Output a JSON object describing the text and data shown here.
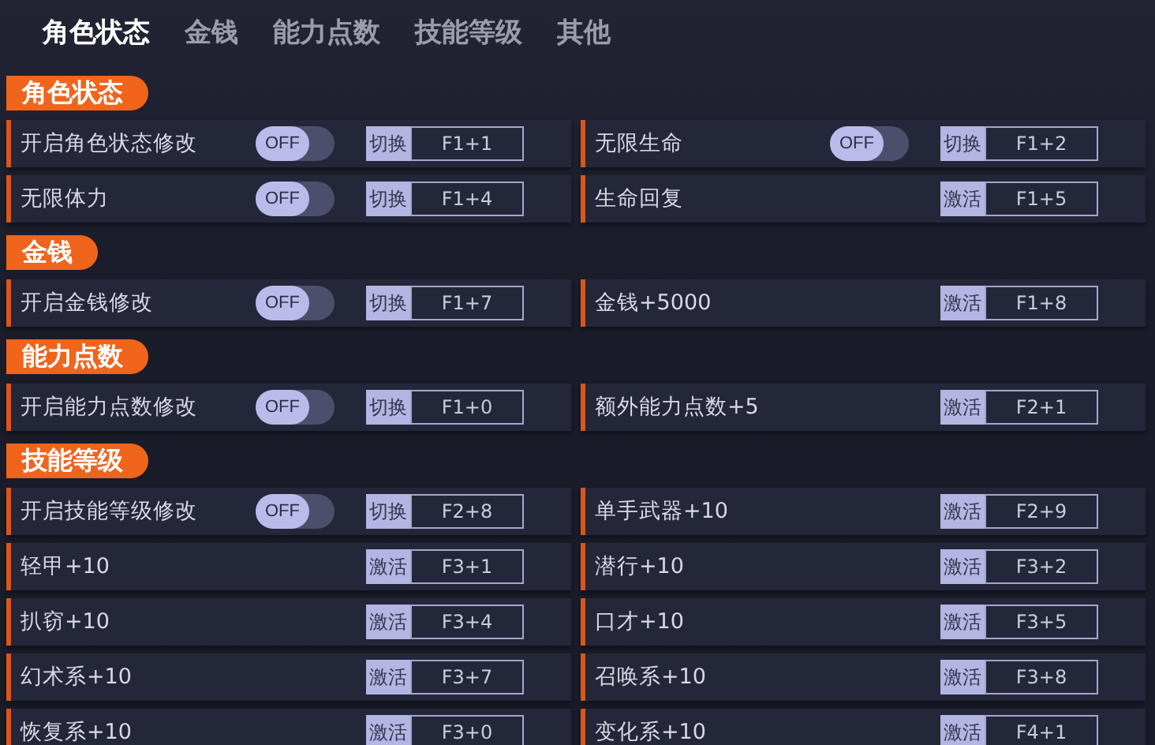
{
  "tabs": [
    {
      "label": "角色状态",
      "selected": true
    },
    {
      "label": "金钱",
      "selected": false
    },
    {
      "label": "能力点数",
      "selected": false
    },
    {
      "label": "技能等级",
      "selected": false
    },
    {
      "label": "其他",
      "selected": false
    }
  ],
  "sections": [
    {
      "title": "角色状态",
      "items": [
        {
          "label": "开启角色状态修改",
          "toggle": {
            "text": "OFF",
            "on": false
          },
          "action": "切换",
          "hotkey": "F1+1"
        },
        {
          "label": "无限生命",
          "toggle": {
            "text": "OFF",
            "on": false
          },
          "action": "切换",
          "hotkey": "F1+2"
        },
        {
          "label": "无限体力",
          "toggle": {
            "text": "OFF",
            "on": false
          },
          "action": "切换",
          "hotkey": "F1+4"
        },
        {
          "label": "生命回复",
          "action": "激活",
          "hotkey": "F1+5"
        }
      ]
    },
    {
      "title": "金钱",
      "items": [
        {
          "label": "开启金钱修改",
          "toggle": {
            "text": "OFF",
            "on": false
          },
          "action": "切换",
          "hotkey": "F1+7"
        },
        {
          "label": "金钱+5000",
          "action": "激活",
          "hotkey": "F1+8"
        }
      ]
    },
    {
      "title": "能力点数",
      "items": [
        {
          "label": "开启能力点数修改",
          "toggle": {
            "text": "OFF",
            "on": false
          },
          "action": "切换",
          "hotkey": "F1+0"
        },
        {
          "label": "额外能力点数+5",
          "action": "激活",
          "hotkey": "F2+1"
        }
      ]
    },
    {
      "title": "技能等级",
      "items": [
        {
          "label": "开启技能等级修改",
          "toggle": {
            "text": "OFF",
            "on": false
          },
          "action": "切换",
          "hotkey": "F2+8"
        },
        {
          "label": "单手武器+10",
          "action": "激活",
          "hotkey": "F2+9"
        },
        {
          "label": "轻甲+10",
          "action": "激活",
          "hotkey": "F3+1"
        },
        {
          "label": "潜行+10",
          "action": "激活",
          "hotkey": "F3+2"
        },
        {
          "label": "扒窃+10",
          "action": "激活",
          "hotkey": "F3+4"
        },
        {
          "label": "口才+10",
          "action": "激活",
          "hotkey": "F3+5"
        },
        {
          "label": "幻术系+10",
          "action": "激活",
          "hotkey": "F3+7"
        },
        {
          "label": "召唤系+10",
          "action": "激活",
          "hotkey": "F3+8"
        },
        {
          "label": "恢复系+10",
          "action": "激活",
          "hotkey": "F3+0"
        },
        {
          "label": "变化系+10",
          "action": "激活",
          "hotkey": "F4+1"
        }
      ]
    }
  ]
}
